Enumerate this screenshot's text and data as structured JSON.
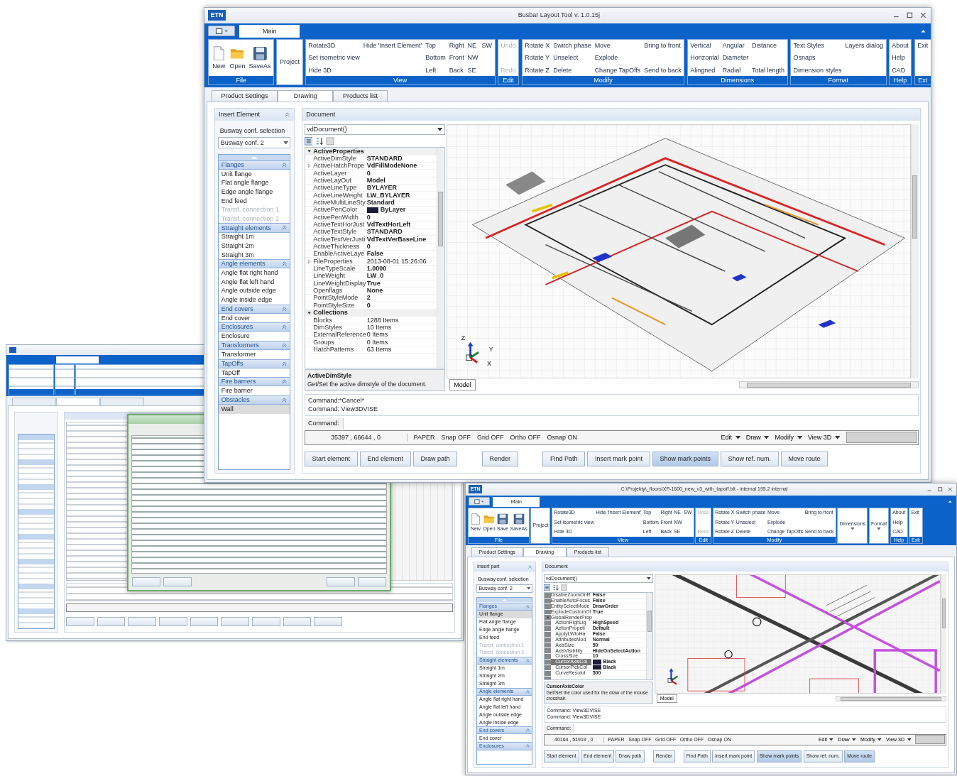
{
  "back_window": {
    "dialog_open": true
  },
  "main_window": {
    "logo_text": "ETN",
    "title": "Busbar Layout Tool v. 1.0.15j",
    "ribbon_tab": "Main",
    "ribbon": [
      {
        "label": "File",
        "kind": "large",
        "disabled": false,
        "items": [
          "New",
          "Open",
          "SaveAs"
        ]
      },
      {
        "kind": "plain",
        "disabled": false,
        "items": [
          "Project"
        ]
      },
      {
        "label": "View",
        "kind": "grid",
        "disabled": false,
        "columns": [
          [
            "Rotate3D",
            "Set isometric view",
            "Hide 3D"
          ],
          [
            "Hide 'Insert Element'"
          ],
          [
            "Top",
            "Bottom",
            "Left"
          ],
          [
            "Right",
            "Front",
            "Back"
          ],
          [
            "NE",
            "NW",
            "SE"
          ],
          [
            "SW"
          ]
        ]
      },
      {
        "label": "Edit",
        "kind": "grid",
        "disabled": true,
        "columns": [
          [
            "Undo",
            "Redo"
          ]
        ]
      },
      {
        "label": "Modify",
        "kind": "grid",
        "disabled": false,
        "columns": [
          [
            "Rotate X",
            "Rotate Y",
            "Rotate Z"
          ],
          [
            "Switch phase",
            "Unselect",
            "Delete"
          ],
          [
            "Move",
            "Explode",
            "Change TapOffs"
          ],
          [
            "Bring to front",
            "Send to back"
          ]
        ]
      },
      {
        "label": "Dimensions",
        "kind": "grid",
        "disabled": false,
        "columns": [
          [
            "Vertical",
            "Horizontal",
            "Alingned"
          ],
          [
            "Angular",
            "Diameter",
            "Radial"
          ],
          [
            "Distance",
            "Total length"
          ]
        ]
      },
      {
        "label": "Format",
        "kind": "grid",
        "disabled": false,
        "columns": [
          [
            "Text Styles",
            "Osnaps",
            "Dimension styles"
          ],
          [
            "Layers dialog"
          ]
        ]
      },
      {
        "label": "Help",
        "kind": "grid",
        "disabled": false,
        "columns": [
          [
            "About",
            "Help",
            "CAD"
          ]
        ]
      },
      {
        "label": "Ext",
        "kind": "grid",
        "disabled": false,
        "columns": [
          [
            "Exit"
          ]
        ]
      }
    ],
    "tabs": [
      {
        "label": "Product Settings",
        "selected": false
      },
      {
        "label": "Drawing",
        "selected": true
      },
      {
        "label": "Products list",
        "selected": false
      }
    ],
    "sidebar": {
      "header": "Insert Element",
      "conf_label": "Busway conf. selection",
      "conf_value": "Busway conf. 2",
      "sections": [
        {
          "title": "Flanges",
          "items": [
            {
              "label": "Unit flange",
              "selected": false,
              "disabled": false
            },
            {
              "label": "Flat angle flange",
              "selected": false,
              "disabled": false
            },
            {
              "label": "Edge angle flange",
              "selected": false,
              "disabled": false
            },
            {
              "label": "End feed",
              "selected": false,
              "disabled": false
            },
            {
              "label": "Transf. connection 1",
              "selected": false,
              "disabled": true
            },
            {
              "label": "Transf. connection 2",
              "selected": false,
              "disabled": true
            }
          ]
        },
        {
          "title": "Straight elements",
          "items": [
            {
              "label": "Straight 1m",
              "selected": false,
              "disabled": false
            },
            {
              "label": "Straight 2m",
              "selected": false,
              "disabled": false
            },
            {
              "label": "Straight 3m",
              "selected": false,
              "disabled": false
            }
          ]
        },
        {
          "title": "Angle elements",
          "items": [
            {
              "label": "Angle flat right hand",
              "selected": false,
              "disabled": false
            },
            {
              "label": "Angle flat left hand",
              "selected": false,
              "disabled": false
            },
            {
              "label": "Angle outside edge",
              "selected": false,
              "disabled": false
            },
            {
              "label": "Angle inside edge",
              "selected": false,
              "disabled": false
            }
          ]
        },
        {
          "title": "End covers",
          "items": [
            {
              "label": "End cover",
              "selected": false,
              "disabled": false
            }
          ]
        },
        {
          "title": "Enclosures",
          "items": [
            {
              "label": "Enclosure",
              "selected": false,
              "disabled": false
            }
          ]
        },
        {
          "title": "Transformers",
          "items": [
            {
              "label": "Transformer",
              "selected": false,
              "disabled": false
            }
          ]
        },
        {
          "title": "TapOffs",
          "items": [
            {
              "label": "TapOff",
              "selected": false,
              "disabled": false
            }
          ]
        },
        {
          "title": "Fire barriers",
          "items": [
            {
              "label": "Fire barrier",
              "selected": false,
              "disabled": false
            }
          ]
        },
        {
          "title": "Obstacles",
          "items": [
            {
              "label": "Wall",
              "selected": true,
              "disabled": false
            }
          ]
        }
      ]
    },
    "document": {
      "header": "Document",
      "selector": "vdDocument()",
      "properties": [
        {
          "kind": "category",
          "name": "ActiveProperties",
          "expanded": true,
          "children": [
            {
              "kind": "property",
              "name": "ActiveDimStyle",
              "value": "STANDARD",
              "modified": true
            },
            {
              "kind": "property",
              "name": "ActiveHatchPrope",
              "value": "VdFillModeNone",
              "modified": true,
              "expanded": false
            },
            {
              "kind": "property",
              "name": "ActiveLayer",
              "value": "0",
              "modified": true
            },
            {
              "kind": "property",
              "name": "ActiveLayOut",
              "value": "Model",
              "modified": true
            },
            {
              "kind": "property",
              "name": "ActiveLineType",
              "value": "BYLAYER",
              "modified": true
            },
            {
              "kind": "property",
              "name": "ActiveLineWeight",
              "value": "LW_BYLAYER",
              "modified": true
            },
            {
              "kind": "property",
              "name": "ActiveMultiLineSty",
              "value": "Standard",
              "modified": true
            },
            {
              "kind": "property",
              "name": "ActivePenColor",
              "value": "ByLayer",
              "modified": true,
              "color": "#1a1a3a"
            },
            {
              "kind": "property",
              "name": "ActivePenWidth",
              "value": "0",
              "modified": true
            },
            {
              "kind": "property",
              "name": "ActiveTextHorJust",
              "value": "VdTextHorLeft",
              "modified": true
            },
            {
              "kind": "property",
              "name": "ActiveTextStyle",
              "value": "STANDARD",
              "modified": true
            },
            {
              "kind": "property",
              "name": "ActiveTextVerJusti",
              "value": "VdTextVerBaseLine",
              "modified": true
            },
            {
              "kind": "property",
              "name": "ActiveThickness",
              "value": "0",
              "modified": true
            },
            {
              "kind": "property",
              "name": "EnableActiveLaye",
              "value": "False",
              "modified": true
            },
            {
              "kind": "property",
              "name": "FileProperties",
              "value": "2013-08-01 15:26:06",
              "modified": false,
              "expanded": false
            },
            {
              "kind": "property",
              "name": "LineTypeScale",
              "value": "1.0000",
              "modified": true
            },
            {
              "kind": "property",
              "name": "LineWeight",
              "value": "LW_0",
              "modified": true
            },
            {
              "kind": "property",
              "name": "LineWeightDisplay",
              "value": "True",
              "modified": true
            },
            {
              "kind": "property",
              "name": "Openflags",
              "value": "None",
              "modified": true
            },
            {
              "kind": "property",
              "name": "PointStyleMode",
              "value": "2",
              "modified": true
            },
            {
              "kind": "property",
              "name": "PointStyleSize",
              "value": "0",
              "modified": true
            }
          ]
        },
        {
          "kind": "category",
          "name": "Collections",
          "expanded": true,
          "children": [
            {
              "kind": "property",
              "name": "Blocks",
              "value": "1288 Items",
              "modified": false
            },
            {
              "kind": "property",
              "name": "DimStyles",
              "value": "10 Items",
              "modified": false
            },
            {
              "kind": "property",
              "name": "ExternalReference",
              "value": "0 Items",
              "modified": false
            },
            {
              "kind": "property",
              "name": "Groups",
              "value": "0 Items",
              "modified": false
            },
            {
              "kind": "property",
              "name": "HatchPatterns",
              "value": "63 Items",
              "modified": false
            }
          ]
        }
      ],
      "description": {
        "title": "ActiveDimStyle",
        "text": "Get/Set the active dimstyle of the document."
      },
      "canvas": {
        "kind": "overview",
        "axis_labels": [
          "Z",
          "Y",
          "X"
        ]
      },
      "model_tab": "Model",
      "commands": [
        "Command:*Cancel*",
        "Command: View3DVISE"
      ],
      "command_label": "Command:",
      "status": {
        "coords": "35397 , 66644 , 0",
        "toggles": [
          "PAPER",
          "Snap OFF",
          "Grid OFF",
          "Ortho OFF",
          "Osnap ON"
        ],
        "menus": [
          "Edit",
          "Draw",
          "Modify",
          "View 3D"
        ]
      },
      "actions": [
        {
          "label": "Start element",
          "selected": false
        },
        {
          "label": "End element",
          "selected": false
        },
        {
          "label": "Draw path",
          "selected": false
        },
        {
          "label": "Render",
          "selected": false
        },
        {
          "label": "Find Path",
          "selected": false
        },
        {
          "label": "Insert mark point",
          "selected": false
        },
        {
          "label": "Show mark points",
          "selected": true
        },
        {
          "label": "Show ref. num.",
          "selected": false
        },
        {
          "label": "Move route",
          "selected": false
        }
      ]
    }
  },
  "front_window": {
    "logo_text": "ETN",
    "title": "C:\\Projekty\\_floors\\XP-1600_new_v3_with_tapoff.blt - internal 195.2 internal",
    "ribbon_tab": "Main",
    "ribbon": [
      {
        "label": "File",
        "kind": "large",
        "disabled": false,
        "items": [
          "New",
          "Open",
          "Save",
          "SaveAs"
        ]
      },
      {
        "kind": "plain",
        "disabled": false,
        "items": [
          "Project"
        ]
      },
      {
        "label": "View",
        "kind": "grid",
        "disabled": false,
        "columns": [
          [
            "Rotate3D",
            "Set isometric view",
            "Hide 3D"
          ],
          [
            "Hide 'Insert Element'"
          ],
          [
            "Top",
            "Bottom",
            "Left"
          ],
          [
            "Right",
            "Front",
            "Back"
          ],
          [
            "NE",
            "NW",
            "SE"
          ],
          [
            "SW"
          ]
        ]
      },
      {
        "label": "Edit",
        "kind": "grid",
        "disabled": true,
        "columns": [
          [
            "Undo",
            "Redo"
          ]
        ]
      },
      {
        "label": "Modify",
        "kind": "grid",
        "disabled": false,
        "columns": [
          [
            "Rotate X",
            "Rotate Y",
            "Rotate Z"
          ],
          [
            "Switch phase",
            "Unselect",
            "Delete"
          ],
          [
            "Move",
            "Explode",
            "Change TapOffs"
          ],
          [
            "Bring to front",
            "Send to back"
          ]
        ]
      },
      {
        "kind": "dropdown",
        "disabled": false,
        "items": [
          "Dimensions"
        ]
      },
      {
        "kind": "dropdown",
        "disabled": false,
        "items": [
          "Format"
        ]
      },
      {
        "label": "Help",
        "kind": "grid",
        "disabled": false,
        "columns": [
          [
            "About",
            "Help",
            "CAD"
          ]
        ]
      },
      {
        "label": "Exit",
        "kind": "grid",
        "disabled": false,
        "columns": [
          [
            "Exit"
          ]
        ]
      }
    ],
    "tabs": [
      {
        "label": "Product Settings",
        "selected": false
      },
      {
        "label": "Drawing",
        "selected": true
      },
      {
        "label": "Products list",
        "selected": false
      }
    ],
    "sidebar": {
      "header": "Insert part",
      "conf_label": "Busway conf. selection",
      "conf_value": "Busway conf. 2",
      "sections": [
        {
          "title": "Flanges",
          "items": [
            {
              "label": "Unit flange",
              "selected": true,
              "disabled": false
            },
            {
              "label": "Flat angle flange",
              "selected": false,
              "disabled": false
            },
            {
              "label": "Edge angle flange",
              "selected": false,
              "disabled": false
            },
            {
              "label": "End feed",
              "selected": false,
              "disabled": false
            },
            {
              "label": "Transf. connection 1",
              "selected": false,
              "disabled": true
            },
            {
              "label": "Transf. connection 2",
              "selected": false,
              "disabled": true
            }
          ]
        },
        {
          "title": "Straight elements",
          "items": [
            {
              "label": "Straight 1m",
              "selected": false,
              "disabled": false
            },
            {
              "label": "Straight 2m",
              "selected": false,
              "disabled": false
            },
            {
              "label": "Straight 3m",
              "selected": false,
              "disabled": false
            }
          ]
        },
        {
          "title": "Angle elements",
          "items": [
            {
              "label": "Angle flat right hand",
              "selected": false,
              "disabled": false
            },
            {
              "label": "Angle flat left hand",
              "selected": false,
              "disabled": false
            },
            {
              "label": "Angle outside edge",
              "selected": false,
              "disabled": false
            },
            {
              "label": "Angle inside edge",
              "selected": false,
              "disabled": false
            }
          ]
        },
        {
          "title": "End covers",
          "items": [
            {
              "label": "End cover",
              "selected": false,
              "disabled": false
            }
          ]
        },
        {
          "title": "Enclosures"
        }
      ]
    },
    "document": {
      "header": "Document",
      "selector": "vdDocument()",
      "properties": [
        {
          "kind": "property",
          "name": "DisableZoomOnR",
          "value": "False",
          "modified": true,
          "selected": false
        },
        {
          "kind": "property",
          "name": "EnableAutoFocus",
          "value": "False",
          "modified": true,
          "selected": false
        },
        {
          "kind": "property",
          "name": "EntitySelectMode",
          "value": "DrawOrder",
          "modified": true,
          "selected": false
        },
        {
          "kind": "property",
          "name": "ExplodeCustomOl",
          "value": "True",
          "modified": true,
          "selected": false
        },
        {
          "kind": "property",
          "name": "GlobalRenderProp",
          "expanded": true,
          "selected": false,
          "children": [
            {
              "kind": "property",
              "name": "ActionHighLig",
              "value": "HighSpeed",
              "modified": true,
              "selected": false
            },
            {
              "kind": "property",
              "name": "ActionPropeti",
              "value": "Default",
              "modified": true,
              "selected": false
            },
            {
              "kind": "property",
              "name": "ApplyLWtoHa",
              "value": "False",
              "modified": true,
              "selected": false
            },
            {
              "kind": "property",
              "name": "AttributesMod",
              "value": "Normal",
              "modified": true,
              "selected": false
            },
            {
              "kind": "property",
              "name": "AxisSize",
              "value": "50",
              "modified": true,
              "selected": false
            },
            {
              "kind": "property",
              "name": "AxisVisibility",
              "value": "HideOnSelectAction",
              "modified": true,
              "selected": false
            },
            {
              "kind": "property",
              "name": "CrossSize",
              "value": "10",
              "modified": true,
              "selected": false
            },
            {
              "kind": "property",
              "name": "CursorAxisCol",
              "value": "Black",
              "modified": true,
              "color": "#1a1a3a",
              "selected": true
            },
            {
              "kind": "property",
              "name": "CursorPickCol",
              "value": "Black",
              "modified": true,
              "color": "#1a1a3a",
              "selected": false
            },
            {
              "kind": "property",
              "name": "CurveResolut",
              "value": "500",
              "modified": true,
              "selected": false
            }
          ]
        }
      ],
      "description": {
        "title": "CursorAxisColor",
        "text": "Get/Set the color used for the draw of the mouse crosshair."
      },
      "canvas": {
        "kind": "closeup"
      },
      "model_tab": "Model",
      "commands": [
        "Command: View3DVISE",
        "Command: View3DVISE"
      ],
      "command_label": "Command:",
      "status": {
        "coords": "40164 , 51919 , 0",
        "toggles": [
          "PAPER",
          "Snap OFF",
          "Grid OFF",
          "Ortho OFF",
          "Osnap ON"
        ],
        "menus": [
          "Edit",
          "Draw",
          "Modify",
          "View 3D"
        ]
      },
      "actions": [
        {
          "label": "Start element",
          "selected": false
        },
        {
          "label": "End element",
          "selected": false
        },
        {
          "label": "Draw path",
          "selected": false
        },
        {
          "label": "Render",
          "selected": false
        },
        {
          "label": "Find Path",
          "selected": false
        },
        {
          "label": "Insert mark point",
          "selected": false
        },
        {
          "label": "Show mark points",
          "selected": true
        },
        {
          "label": "Show ref. num.",
          "selected": false
        },
        {
          "label": "Move route",
          "selected": true
        }
      ]
    }
  }
}
